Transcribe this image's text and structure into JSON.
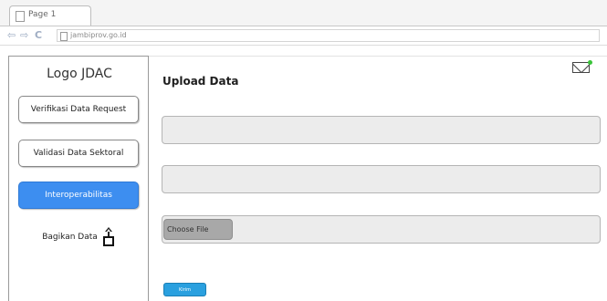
{
  "browser": {
    "tab_title": "Page 1",
    "url": "jambiprov.go.id",
    "icons": [
      "back-arrow-icon",
      "forward-arrow-icon",
      "reload-icon",
      "page-icon"
    ]
  },
  "sidebar": {
    "logo": "Logo JDAC",
    "items": [
      {
        "label": "Verifikasi Data Request",
        "active": false
      },
      {
        "label": "Validasi Data Sektoral",
        "active": false
      },
      {
        "label": "Interoperabilitas",
        "active": true
      },
      {
        "label": "Bagikan Data",
        "icon": "share-icon"
      }
    ]
  },
  "main": {
    "title": "Upload Data",
    "mail_icon": "mail-icon",
    "fields": [
      {
        "value": ""
      },
      {
        "value": ""
      }
    ],
    "file_input": {
      "button_label": "Choose File"
    },
    "submit": {
      "label": "Kirim"
    }
  },
  "colors": {
    "active_button": "#3d8ef0",
    "submit_button": "#2aa0df",
    "notification_dot": "#3ac43a"
  }
}
